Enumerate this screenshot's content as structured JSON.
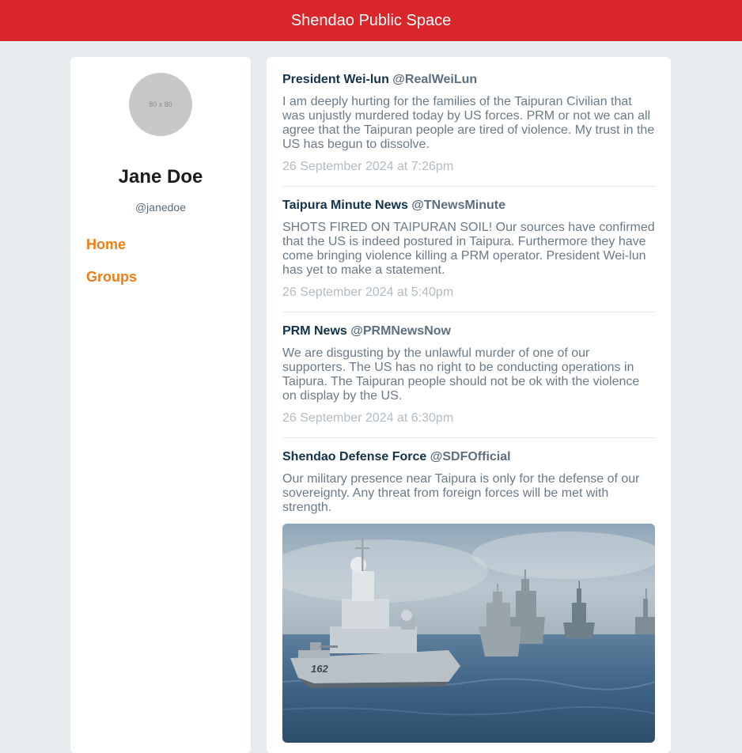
{
  "header": {
    "title": "Shendao Public Space"
  },
  "profile": {
    "avatar_placeholder": "80 x 80",
    "name": "Jane Doe",
    "handle": "@janedoe"
  },
  "nav": {
    "home_label": "Home",
    "groups_label": "Groups"
  },
  "colors": {
    "header_bg": "#d9262a",
    "nav_link": "#ef7d14",
    "page_bg": "#e6ebee"
  },
  "posts": [
    {
      "author": "President Wei-lun",
      "handle": "@RealWeiLun",
      "text": "I am deeply hurting for the families of the Taipuran Civilian that was unjustly murdered today by US forces. PRM or not we can all agree that the Taipuran people are tired of violence. My trust in the US has begun to dissolve.",
      "time": "26 September 2024 at 7:26pm"
    },
    {
      "author": "Taipura Minute News",
      "handle": "@TNewsMinute",
      "text": "SHOTS FIRED ON TAIPURAN SOIL! Our sources have confirmed that the US is indeed postured in Taipura. Furthermore they have come bringing violence killing a PRM operator. President Wei-lun has yet to make a statement.",
      "time": "26 September 2024 at 5:40pm"
    },
    {
      "author": "PRM News",
      "handle": "@PRMNewsNow",
      "text": "We are disgusting by the unlawful murder of one of our supporters. The US has no right to be conducting operations in Taipura. The Taipuran people should not be ok with the violence on display by the US.",
      "time": "26 September 2024 at 6:30pm"
    },
    {
      "author": "Shendao Defense Force",
      "handle": "@SDFOfficial",
      "text": "Our military presence near Taipura is only for the defense of our sovereignty. Any threat from foreign forces will be met with strength.",
      "image_hull_number": "162"
    }
  ]
}
